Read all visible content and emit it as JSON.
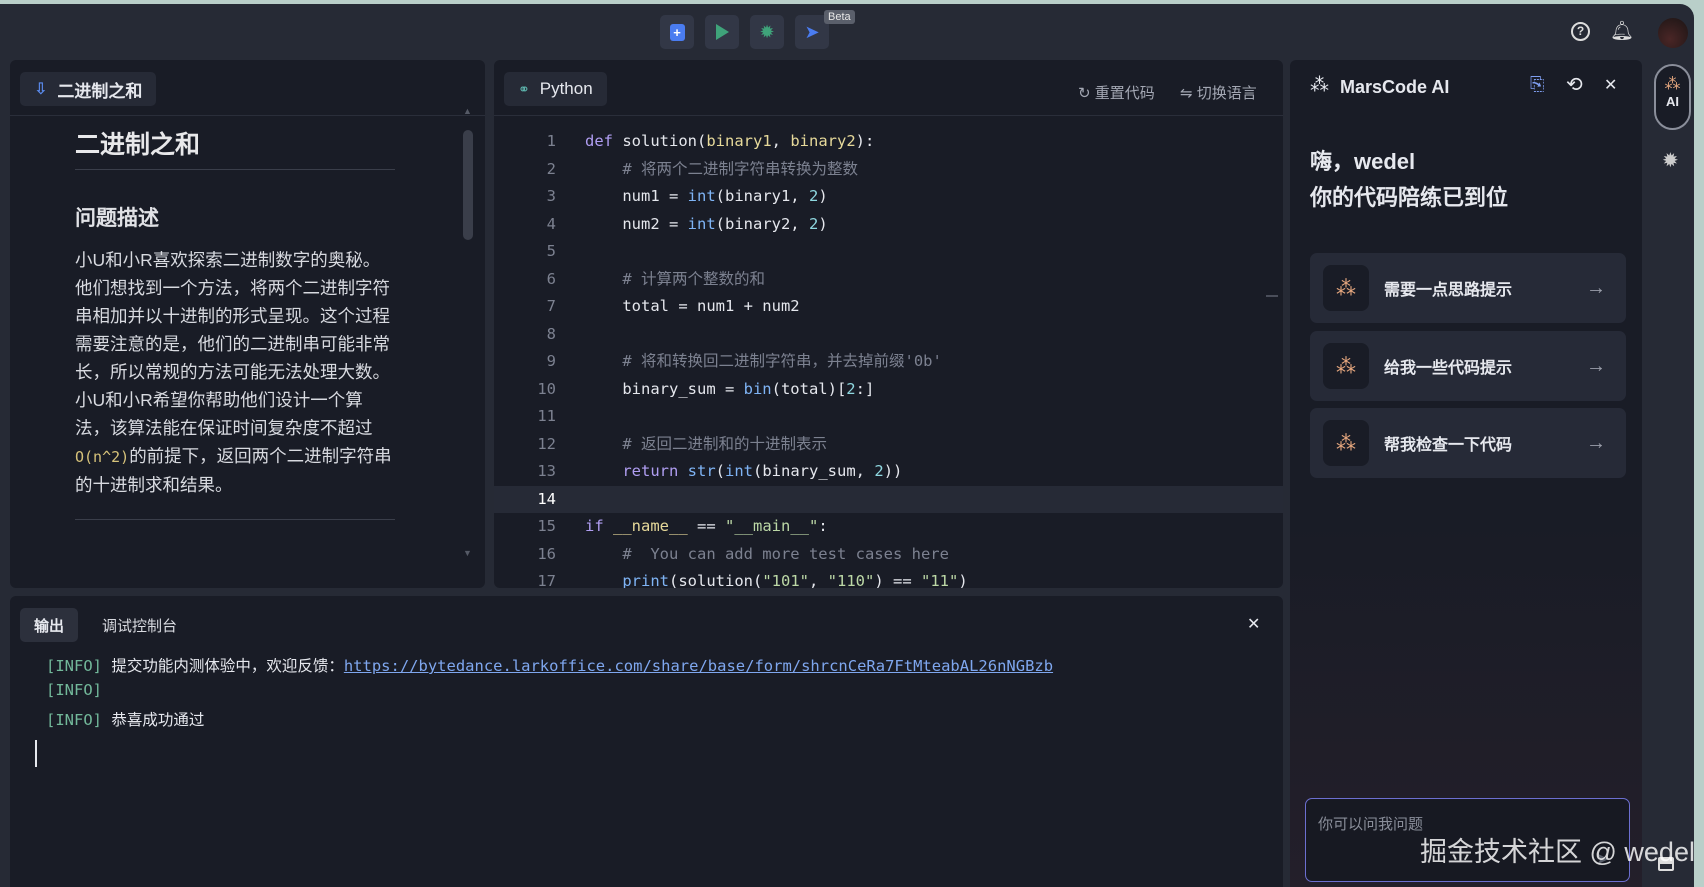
{
  "toolbar": {
    "beta": "Beta",
    "submit": "submit",
    "run": "run",
    "debug": "debug",
    "send": "send"
  },
  "problem": {
    "tab": "二进制之和",
    "title": "二进制之和",
    "section": "问题描述",
    "desc_before": "小U和小R喜欢探索二进制数字的奥秘。他们想找到一个方法，将两个二进制字符串相加并以十进制的形式呈现。这个过程需要注意的是，他们的二进制串可能非常长，所以常规的方法可能无法处理大数。小U和小R希望你帮助他们设计一个算法，该算法能在保证时间复杂度不超过",
    "desc_code": "O(n^2)",
    "desc_after": "的前提下，返回两个二进制字符串的十进制求和结果。"
  },
  "editor": {
    "language": "Python",
    "reset": "重置代码",
    "switch": "切换语言",
    "current_line": 14
  },
  "output": {
    "tabs": [
      "输出",
      "调试控制台"
    ],
    "lines": [
      {
        "tag": "[INFO]",
        "text": " 提交功能内测体验中，欢迎反馈：",
        "link": "https://bytedance.larkoffice.com/share/base/form/shrcnCeRa7FtMteabAL26nNGBzb"
      },
      {
        "tag": "[INFO]",
        "text": ""
      },
      {
        "tag": "[INFO]",
        "text": " 恭喜成功通过"
      }
    ]
  },
  "ai": {
    "title": "MarsCode AI",
    "greeting1": "嗨，wedel",
    "greeting2": "你的代码陪练已到位",
    "cards": [
      "需要一点思路提示",
      "给我一些代码提示",
      "帮我检查一下代码"
    ],
    "placeholder": "你可以问我问题",
    "rail_label": "AI",
    "watermark": "掘金技术社区 @ wedel"
  }
}
